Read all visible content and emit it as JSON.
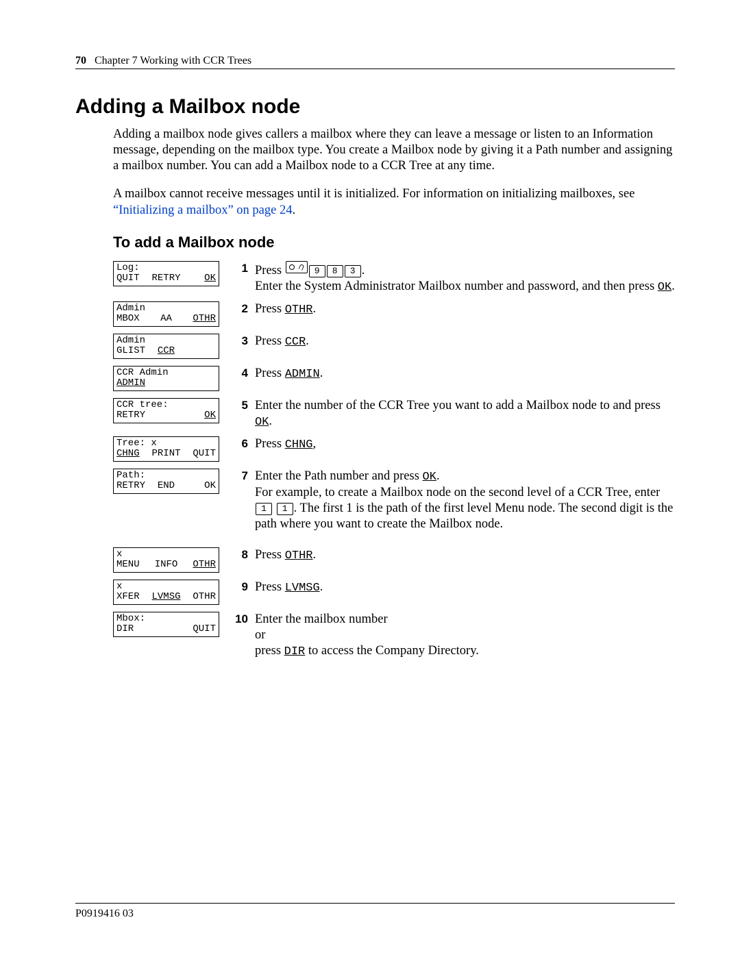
{
  "header": {
    "page_number": "70",
    "chapter": "Chapter 7  Working with CCR Trees"
  },
  "title": "Adding a Mailbox node",
  "intro_p1": "Adding a mailbox node gives callers a mailbox where they can leave a message or listen to an Information message, depending on the mailbox type. You create a Mailbox node by giving it a Path number and assigning a mailbox number. You can add a Mailbox node to a CCR Tree at any time.",
  "intro_p2a": "A mailbox cannot receive messages until it is initialized. For information on initializing mailboxes, see ",
  "intro_link": "“Initializing a mailbox” on page 24",
  "intro_p2b": ".",
  "subtitle": "To add a Mailbox node",
  "steps": [
    {
      "lcd": {
        "top": "Log:",
        "bot": [
          "QUIT",
          "RETRY",
          "OK"
        ],
        "underline": [
          false,
          false,
          true
        ]
      },
      "num": "1",
      "text_parts": {
        "pre": "Press ",
        "keys": [
          "feature",
          "9",
          "8",
          "3"
        ],
        "post": ".",
        "line2a": "Enter the System Administrator Mailbox number and password, and then press ",
        "sk": "OK",
        "line2b": "."
      }
    },
    {
      "lcd": {
        "top": "Admin",
        "bot": [
          "MBOX",
          "AA",
          "OTHR"
        ],
        "underline": [
          false,
          false,
          true
        ]
      },
      "num": "2",
      "text_parts": {
        "pre": "Press ",
        "sk": "OTHR",
        "post": "."
      }
    },
    {
      "lcd": {
        "top": "Admin",
        "bot": [
          "GLIST",
          "CCR",
          ""
        ],
        "underline": [
          false,
          true,
          false
        ]
      },
      "num": "3",
      "text_parts": {
        "pre": "Press ",
        "sk": "CCR",
        "post": "."
      }
    },
    {
      "lcd": {
        "top": "CCR Admin",
        "bot": [
          "ADMIN",
          "",
          ""
        ],
        "underline": [
          true,
          false,
          false
        ]
      },
      "num": "4",
      "text_parts": {
        "pre": "Press ",
        "sk": "ADMIN",
        "post": "."
      }
    },
    {
      "lcd": {
        "top": "CCR tree:",
        "bot": [
          "RETRY",
          "",
          "OK"
        ],
        "underline": [
          false,
          false,
          true
        ]
      },
      "num": "5",
      "text_parts": {
        "pre": "Enter the number of the CCR Tree you want to add a Mailbox node to and press ",
        "sk": "OK",
        "post": "."
      }
    },
    {
      "lcd": {
        "top": "Tree: x",
        "bot": [
          "CHNG",
          "PRINT",
          "QUIT"
        ],
        "underline": [
          true,
          false,
          false
        ]
      },
      "num": "6",
      "text_parts": {
        "pre": "Press ",
        "sk": "CHNG",
        "post": ","
      }
    },
    {
      "lcd": {
        "top": "Path:",
        "bot": [
          "RETRY",
          "END",
          "OK"
        ],
        "underline": [
          false,
          false,
          false
        ]
      },
      "num": "7",
      "text_parts": {
        "pre": "Enter the Path number and press ",
        "sk": "OK",
        "post": ".",
        "line2a": "For example, to create a Mailbox node on the second level of a CCR Tree, enter ",
        "keys": [
          "1",
          "1"
        ],
        "line2b": ". The first 1 is the path of the first level Menu node. The second digit is the path where you want to create the Mailbox node."
      }
    },
    {
      "lcd": {
        "top": "x",
        "bot": [
          "MENU",
          "INFO",
          "OTHR"
        ],
        "underline": [
          false,
          false,
          true
        ]
      },
      "num": "8",
      "text_parts": {
        "pre": "Press ",
        "sk": "OTHR",
        "post": "."
      },
      "gap": true
    },
    {
      "lcd": {
        "top": "x",
        "bot": [
          "XFER",
          "LVMSG",
          "OTHR"
        ],
        "underline": [
          false,
          true,
          false
        ]
      },
      "num": "9",
      "text_parts": {
        "pre": "Press ",
        "sk": "LVMSG",
        "post": "."
      }
    },
    {
      "lcd": {
        "top": "Mbox:",
        "bot": [
          "DIR",
          "",
          "QUIT"
        ],
        "underline": [
          false,
          false,
          false
        ]
      },
      "num": "10",
      "text_parts": {
        "pre": "Enter the mailbox number",
        "line2a": "or",
        "line3a": "press ",
        "sk": "DIR",
        "line3b": " to access the Company Directory."
      }
    }
  ],
  "footer": "P0919416 03"
}
